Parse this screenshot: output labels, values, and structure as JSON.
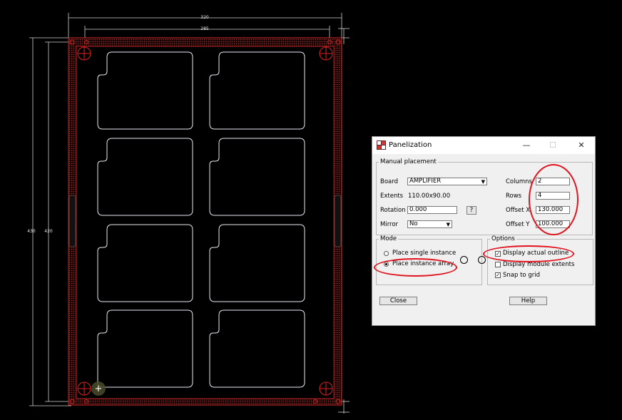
{
  "cad": {
    "dim_top_outer": "320",
    "dim_top_inner": "285",
    "dim_left_outer": "430",
    "dim_left_inner": "420",
    "board_outline_color": "#e8eaf0",
    "panel_rail_color": "#d42828"
  },
  "dialog": {
    "title": "Panelization",
    "title_icon": "panelization-app-icon",
    "window_buttons": {
      "minimize": "—",
      "maximize": "☐",
      "close": "✕"
    },
    "manual_placement": {
      "label": "Manual placement",
      "board_label": "Board",
      "board_value": "AMPLIFIER",
      "extents_label": "Extents",
      "extents_value": "110.00x90.00",
      "rotation_label": "Rotation",
      "rotation_value": "0.000",
      "help_q": "?",
      "mirror_label": "Mirror",
      "mirror_value": "No",
      "columns_label": "Columns",
      "columns_value": "2",
      "rows_label": "Rows",
      "rows_value": "4",
      "offset_x_label": "Offset X",
      "offset_x_value": "130.000",
      "offset_y_label": "Offset Y",
      "offset_y_value": "100.000"
    },
    "mode": {
      "label": "Mode",
      "single": "Place single instance",
      "array": "Place instance array",
      "selected": "array"
    },
    "options": {
      "label": "Options",
      "display_outline": "Display actual outline",
      "display_outline_checked": true,
      "display_extents": "Display module extents",
      "display_extents_checked": false,
      "snap_grid": "Snap to grid",
      "snap_grid_checked": true
    },
    "buttons": {
      "close": "Close",
      "help": "Help"
    },
    "annotation_color": "#e0141e"
  }
}
